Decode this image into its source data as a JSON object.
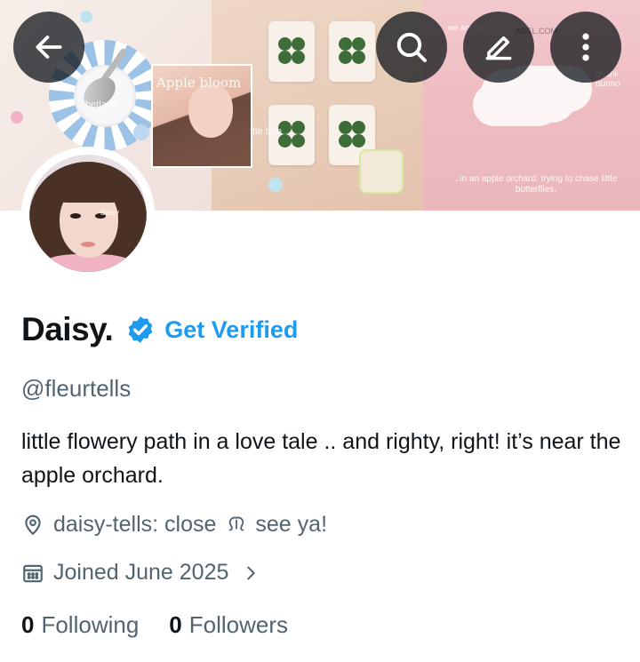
{
  "banner": {
    "caption_top_left": "betlave",
    "caption_photo": "Apple bloom",
    "caption_tile": "little bun",
    "caption_top_right": "we are just",
    "caption_site": "ADEL.COM",
    "caption_right_side": "bushi-bunno",
    "caption_bottom_right": "..in an apple orchard, trying to chase little butterflies."
  },
  "header_buttons": {
    "back_icon": "arrow-left-icon",
    "search_icon": "search-icon",
    "edit_icon": "pencil-icon",
    "more_icon": "more-vertical-icon"
  },
  "avatar": {
    "caption": "daisy"
  },
  "profile": {
    "name": "Daisy.",
    "verified_badge_icon": "verified-badge-icon",
    "get_verified_label": "Get Verified",
    "handle": "@fleurtells",
    "bio": "little flowery path in a love tale .. and righty, right! it’s near the apple orchard.",
    "location_icon": "location-pin-icon",
    "location_text": "daisy-tells: close",
    "location_suffix_icon": "omega-icon",
    "location_suffix": "see ya!",
    "joined_icon": "calendar-icon",
    "joined_text": "Joined June 2025",
    "joined_chevron_icon": "chevron-right-icon",
    "following_count": "0",
    "following_label": "Following",
    "followers_count": "0",
    "followers_label": "Followers"
  },
  "colors": {
    "accent": "#1d9bf0",
    "text_primary": "#0f1419",
    "text_secondary": "#536471",
    "header_button_bg": "#0f1419"
  }
}
